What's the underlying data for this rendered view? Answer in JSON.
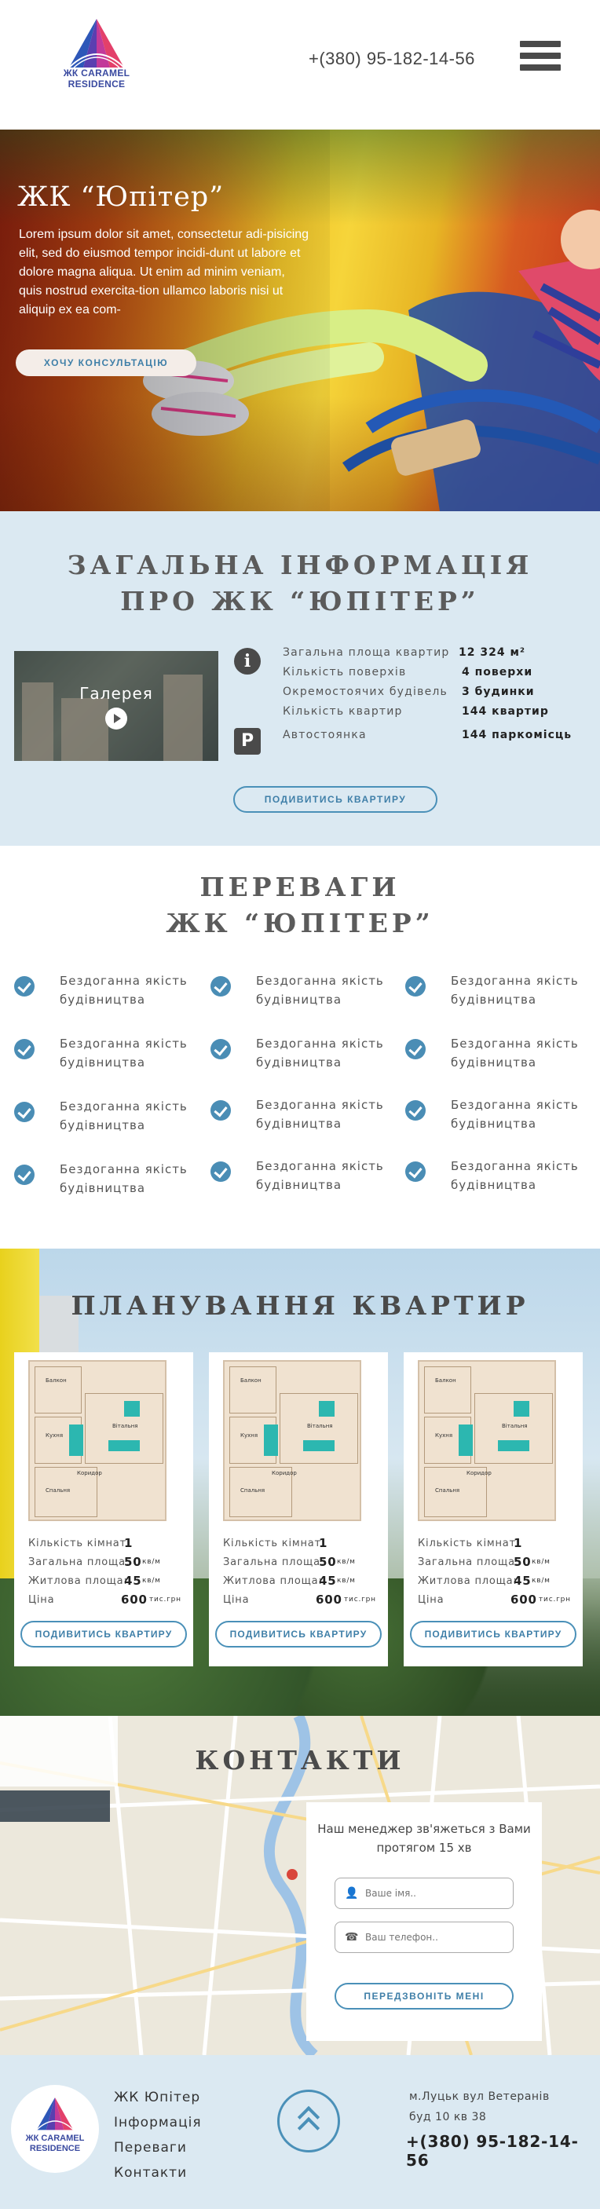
{
  "header": {
    "logo_line1": "ЖК CARAMEL",
    "logo_line2": "RESIDENCE",
    "phone": "+(380) 95-182-14-56"
  },
  "hero": {
    "title": "ЖК “Юпітер”",
    "text": "Lorem ipsum dolor sit amet, consectetur adi-pisicing elit, sed do eiusmod tempor incidi-dunt ut labore et dolore magna aliqua. Ut enim ad minim veniam, quis nostrud exercita-tion ullamco laboris nisi ut aliquip ex ea com-",
    "cta": "ХОЧУ КОНСУЛЬТАЦІЮ"
  },
  "info": {
    "title_line1": "ЗАГАЛЬНА ІНФОРМАЦІЯ",
    "title_line2": "ПРО ЖК “ЮПІТЕР”",
    "gallery_label": "Галерея",
    "facts": [
      {
        "label": "Загальна площа квартир",
        "value": "12 324 м²"
      },
      {
        "label": "Кількість поверхів",
        "value": "4 поверхи"
      },
      {
        "label": "Окремостоячих будівель",
        "value": "3 будинки"
      },
      {
        "label": "Кількість квартир",
        "value": "144 квартир"
      },
      {
        "label": "Автостоянка",
        "value": "144 паркомісць"
      }
    ],
    "button": "ПОДИВИТИСЬ КВАРТИРУ"
  },
  "advantages": {
    "title_line1": "ПЕРЕВАГИ",
    "title_line2": "ЖК “ЮПІТЕР”",
    "items": [
      "Бездоганна якість будівництва",
      "Бездоганна якість будівництва",
      "Бездоганна якість будівництва",
      "Бездоганна якість будівництва",
      "Бездоганна якість будівництва",
      "Бездоганна якість будівництва",
      "Бездоганна якість будівництва",
      "Бездоганна якість будівництва",
      "Бездоганна якість будівництва",
      "Бездоганна якість будівництва",
      "Бездоганна якість будівництва",
      "Бездоганна якість будівництва"
    ]
  },
  "planning": {
    "title": "ПЛАНУВАННЯ КВАРТИР",
    "cards": [
      {
        "rooms_label": "Кількість кімнат:",
        "rooms": "1",
        "area_label": "Загальна площа:",
        "area": "50",
        "area_unit": "кв/м",
        "living_label": "Житлова площа:",
        "living": "45",
        "living_unit": "кв/м",
        "price_label": "Ціна",
        "price": "600",
        "price_unit": "тис.грн",
        "button": "ПОДИВИТИСЬ КВАРТИРУ"
      },
      {
        "rooms_label": "Кількість кімнат:",
        "rooms": "1",
        "area_label": "Загальна площа:",
        "area": "50",
        "area_unit": "кв/м",
        "living_label": "Житлова площа:",
        "living": "45",
        "living_unit": "кв/м",
        "price_label": "Ціна",
        "price": "600",
        "price_unit": "тис.грн",
        "button": "ПОДИВИТИСЬ КВАРТИРУ"
      },
      {
        "rooms_label": "Кількість кімнат:",
        "rooms": "1",
        "area_label": "Загальна площа:",
        "area": "50",
        "area_unit": "кв/м",
        "living_label": "Житлова площа:",
        "living": "45",
        "living_unit": "кв/м",
        "price_label": "Ціна",
        "price": "600",
        "price_unit": "тис.грн",
        "button": "ПОДИВИТИСЬ КВАРТИРУ"
      }
    ],
    "plan_labels": [
      "Кухня",
      "Вітальня",
      "Коридор",
      "Спальня",
      "Балкон"
    ]
  },
  "contacts": {
    "title": "КОНТАКТИ",
    "note": "Наш менеджер зв'яжеться з Вами протягом 15 хв",
    "name_placeholder": "Ваше імя..",
    "phone_placeholder": "Ваш телефон..",
    "button": "ПЕРЕДЗВОНІТЬ МЕНІ"
  },
  "footer": {
    "logo_line1": "ЖК CARAMEL",
    "logo_line2": "RESIDENCE",
    "nav": [
      "ЖК Юпітер",
      "Інформація",
      "Переваги",
      "Контакти"
    ],
    "address_line1": "м.Луцьк вул Ветеранів",
    "address_line2": "буд 10 кв 38",
    "phone": "+(380) 95-182-14-56"
  },
  "colors": {
    "accent": "#4a90b8",
    "info_bg": "#dbe9f2",
    "logo": "#3a4aa0"
  }
}
